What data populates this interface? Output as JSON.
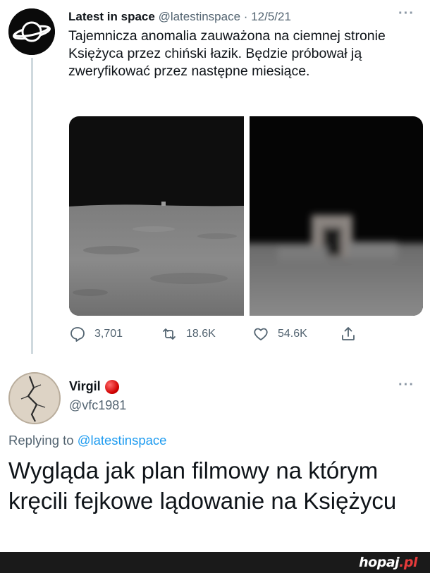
{
  "tweet": {
    "author_name": "Latest in space",
    "author_handle": "@latestinspace",
    "separator": "·",
    "date": "12/5/21",
    "more": "···",
    "text": "Tajemnicza anomalia zauważona na ciemnej stronie Księżyca przez chiński łazik. Będzie próbował ją zweryfikować przez następne miesiące.",
    "actions": {
      "replies": "3,701",
      "retweets": "18.6K",
      "likes": "54.6K"
    }
  },
  "reply": {
    "author_name": "Virgil",
    "author_handle": "@vfc1981",
    "more": "···",
    "replying_prefix": "Replying to",
    "replying_to": "@latestinspace",
    "text": "Wygląda jak plan filmowy na którym kręcili fejkowe lądowanie na Księżycu"
  },
  "footer": {
    "logo_main": "hopaj",
    "logo_suffix": ".pl"
  },
  "colors": {
    "text": "#0f1419",
    "secondary": "#536471",
    "link": "#1d9bf0",
    "badge": "#d00000",
    "footer_bg": "#1a1a1a"
  },
  "icons": [
    "saturn-logo-avatar",
    "reply-icon",
    "retweet-icon",
    "like-icon",
    "share-icon",
    "more-icon"
  ]
}
